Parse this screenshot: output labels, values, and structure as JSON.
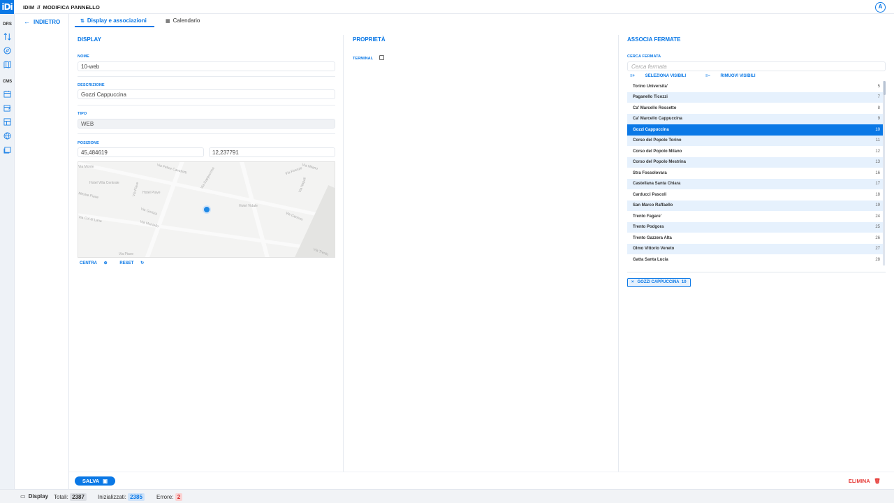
{
  "app": {
    "logo_text": "iDi",
    "breadcrumb_root": "IDIM",
    "breadcrumb_sep": "//",
    "breadcrumb_page": "MODIFICA PANNELLO",
    "avatar_initial": "A"
  },
  "rail": {
    "group1_label": "DRS",
    "group2_label": "CMS"
  },
  "nav": {
    "back_label": "INDIETRO"
  },
  "tabs": [
    {
      "label": "Display e associazioni",
      "icon": "sliders-icon",
      "active": true
    },
    {
      "label": "Calendario",
      "icon": "calendar-icon",
      "active": false
    }
  ],
  "display": {
    "title": "DISPLAY",
    "nome_label": "NOME",
    "nome_value": "10-web",
    "descrizione_label": "DESCRIZIONE",
    "descrizione_value": "Gozzi Cappuccina",
    "tipo_label": "TIPO",
    "tipo_value": "WEB",
    "posizione_label": "POSIZIONE",
    "lat_value": "45,484619",
    "lon_value": "12,237791",
    "centra_label": "CENTRA",
    "reset_label": "RESET"
  },
  "map": {
    "streets": [
      "Via Felice Cavallotti",
      "Via Cappuccina",
      "Via Piave",
      "Via Milano",
      "Via Firenze",
      "Via Napoli",
      "Hotel Villa Centrale",
      "Hotel Piave",
      "Mestre Piave",
      "Via Gorizia",
      "Via Monte",
      "Via Col di Lana",
      "Via Montello",
      "Hotel Vidale",
      "Via Genova",
      "Via Piave",
      "Via Trento"
    ]
  },
  "proprieta": {
    "title": "PROPRIETÀ",
    "terminal_label": "TERMINAL",
    "terminal_checked": false
  },
  "associa": {
    "title": "ASSOCIA FERMATE",
    "cerca_label": "CERCA FERMATA",
    "cerca_placeholder": "Cerca fermata",
    "seleziona_label": "SELEZIONA VISIBILI",
    "rimuovi_label": "RIMUOVI VISIBILI",
    "stops": [
      {
        "name": "Torino Universita'",
        "num": "5"
      },
      {
        "name": "Paganello Ticozzi",
        "num": "7"
      },
      {
        "name": "Ca' Marcello Rossetto",
        "num": "8"
      },
      {
        "name": "Ca' Marcello Cappuccina",
        "num": "9"
      },
      {
        "name": "Gozzi Cappuccina",
        "num": "10",
        "selected": true
      },
      {
        "name": "Corso del Popolo Torino",
        "num": "11"
      },
      {
        "name": "Corso del Popolo Milano",
        "num": "12"
      },
      {
        "name": "Corso del Popolo Mestrina",
        "num": "13"
      },
      {
        "name": "Stra Fossolovara",
        "num": "16"
      },
      {
        "name": "Castellana Santa Chiara",
        "num": "17"
      },
      {
        "name": "Carducci Pascoli",
        "num": "18"
      },
      {
        "name": "San Marco Raffaello",
        "num": "19"
      },
      {
        "name": "Trento Fagare'",
        "num": "24"
      },
      {
        "name": "Trento Podgora",
        "num": "25"
      },
      {
        "name": "Trento Gazzera Alta",
        "num": "26"
      },
      {
        "name": "Olmo Vittorio Veneto",
        "num": "27"
      },
      {
        "name": "Gatta Santa Lucia",
        "num": "28"
      }
    ],
    "chip_close": "×",
    "chip_label": "GOZZI CAPPUCCINA",
    "chip_num": "10"
  },
  "footer": {
    "save_label": "SALVA",
    "delete_label": "ELIMINA"
  },
  "status": {
    "display_label": "Display",
    "totali_label": "Totali:",
    "totali_value": "2387",
    "inizializzati_label": "Inizializzati:",
    "inizializzati_value": "2385",
    "errore_label": "Errore:",
    "errore_value": "2"
  },
  "colors": {
    "accent": "#0a78e6",
    "danger": "#e53935"
  }
}
